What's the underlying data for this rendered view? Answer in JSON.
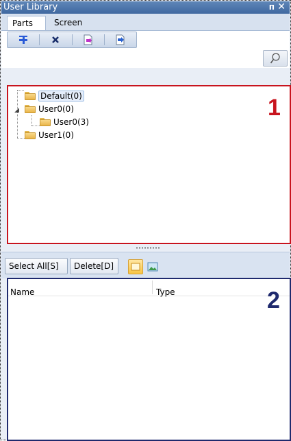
{
  "window": {
    "title": "User Library",
    "pin_glyph": "ᴨ",
    "close_glyph": "✕"
  },
  "tabs": [
    {
      "label": "Parts",
      "active": true
    },
    {
      "label": "Screen",
      "active": false
    }
  ],
  "toolbar": {
    "icons": [
      "add-icon",
      "delete-icon",
      "import-icon",
      "export-icon"
    ]
  },
  "search": {
    "value": "",
    "placeholder": "",
    "icon": "search-icon"
  },
  "tree": {
    "marker": "1",
    "nodes": [
      {
        "label": "Default(0)",
        "level": 0,
        "selected": true
      },
      {
        "label": "User0(0)",
        "level": 0,
        "expanded": true
      },
      {
        "label": "User0(3)",
        "level": 1
      },
      {
        "label": "User1(0)",
        "level": 0
      }
    ]
  },
  "actions": {
    "select_all_label": "Select All[S]",
    "delete_label": "Delete[D]"
  },
  "view_toggles": [
    {
      "icon": "list-view-icon",
      "active": true
    },
    {
      "icon": "thumbnail-view-icon",
      "active": false
    }
  ],
  "list": {
    "marker": "2",
    "columns": [
      "Name",
      "Type"
    ],
    "rows": []
  },
  "colors": {
    "tree_highlight_border": "#c8141e",
    "list_highlight_border": "#1f2a6e",
    "marker_1": "#c8141e",
    "marker_2": "#1f2a6e"
  }
}
